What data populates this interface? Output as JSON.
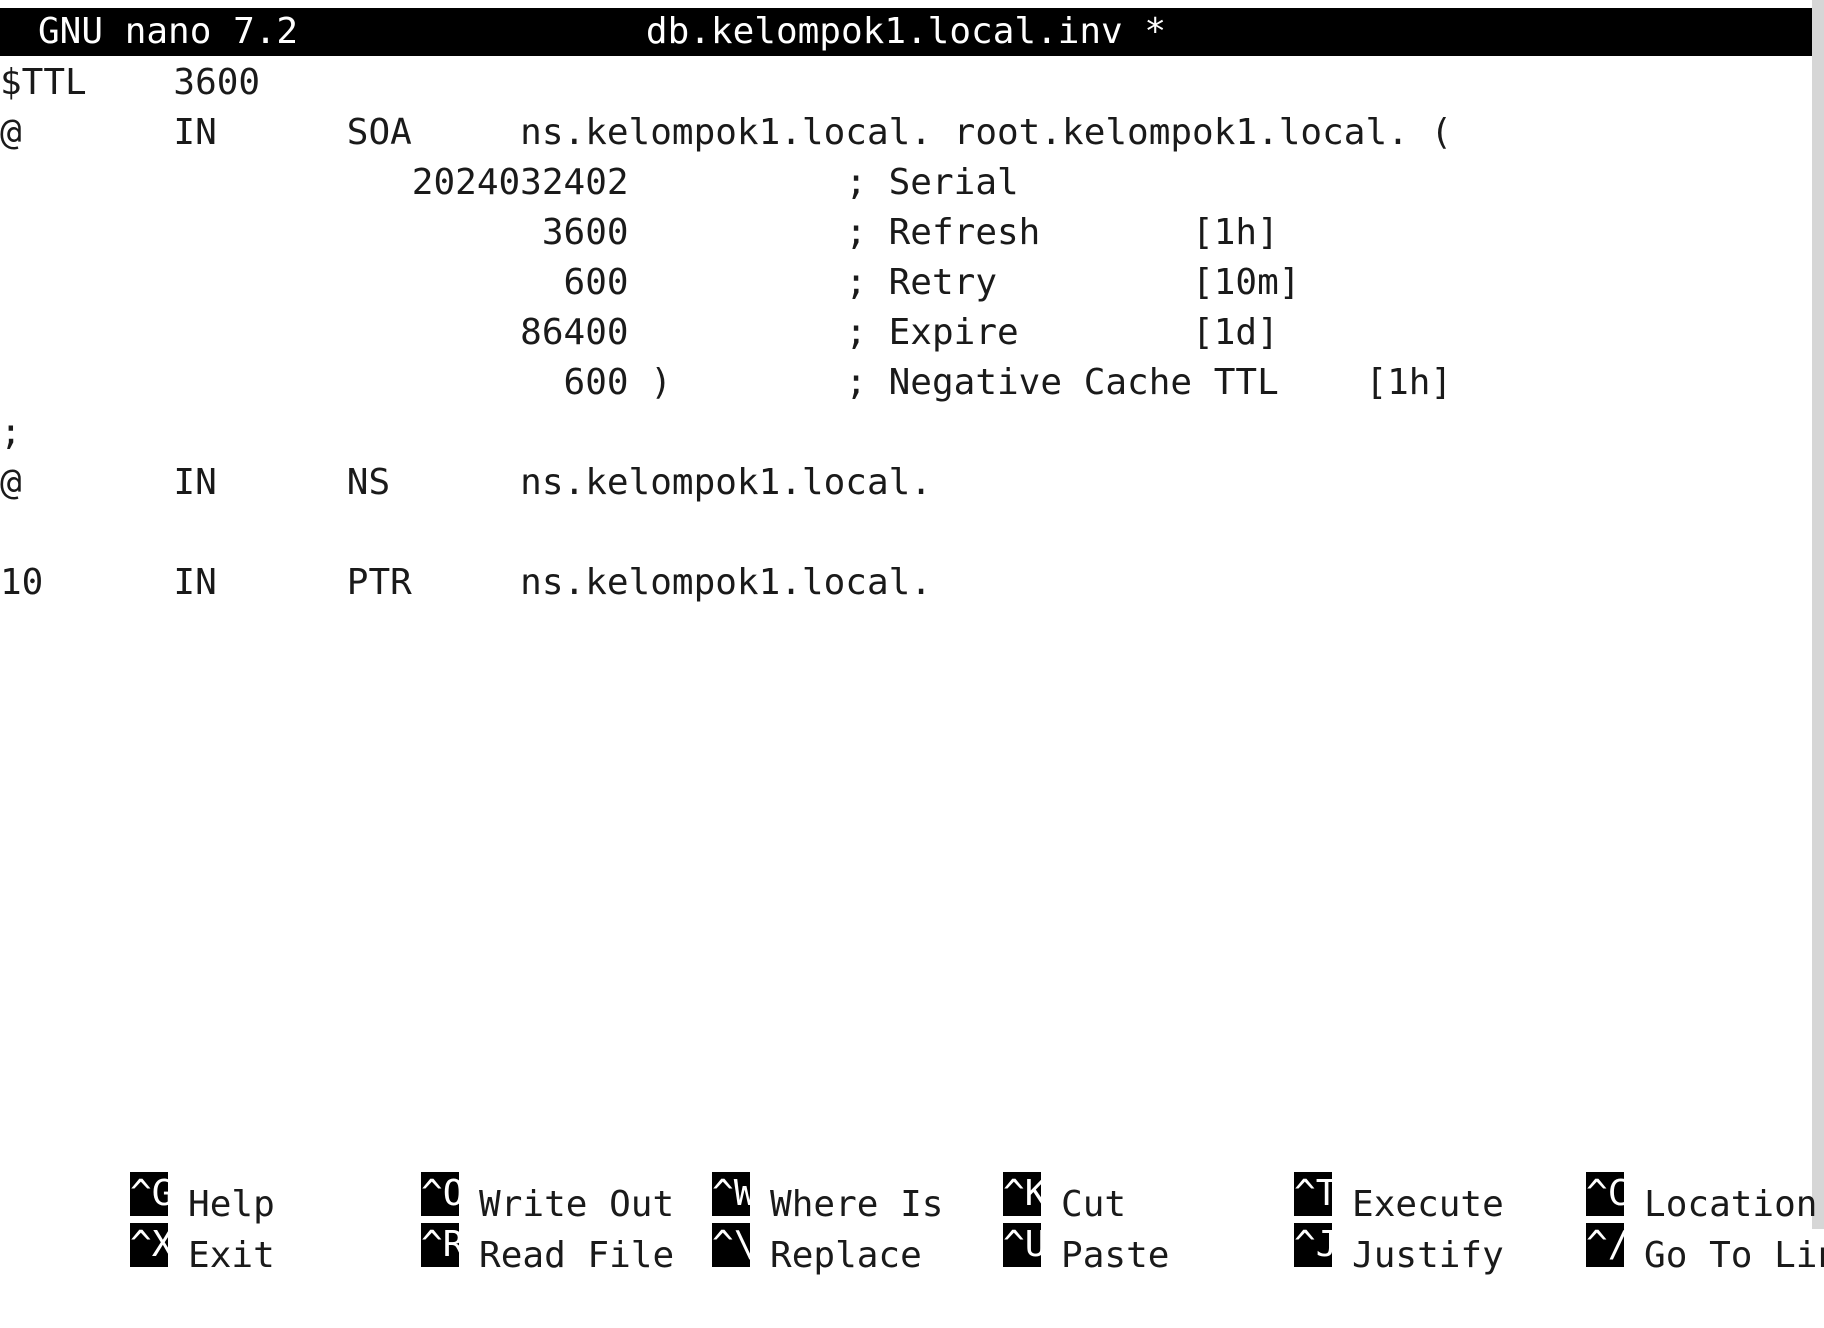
{
  "titlebar": {
    "app_version": "GNU nano 7.2",
    "filename": "db.kelompok1.local.inv *"
  },
  "editor": {
    "lines": [
      "$TTL    3600",
      "@       IN      SOA     ns.kelompok1.local. root.kelompok1.local. (",
      "                   2024032402          ; Serial",
      "                         3600          ; Refresh       [1h]",
      "                          600          ; Retry         [10m]",
      "                        86400          ; Expire        [1d]",
      "                          600 )        ; Negative Cache TTL    [1h]",
      ";",
      "@       IN      NS      ns.kelompok1.local.",
      "",
      "10      IN      PTR     ns.kelompok1.local."
    ]
  },
  "shortcuts": {
    "row1": [
      {
        "key": "^G",
        "label": "Help"
      },
      {
        "key": "^O",
        "label": "Write Out"
      },
      {
        "key": "^W",
        "label": "Where Is"
      },
      {
        "key": "^K",
        "label": "Cut"
      },
      {
        "key": "^T",
        "label": "Execute"
      },
      {
        "key": "^C",
        "label": "Location"
      }
    ],
    "row2": [
      {
        "key": "^X",
        "label": "Exit"
      },
      {
        "key": "^R",
        "label": "Read File"
      },
      {
        "key": "^\\",
        "label": "Replace"
      },
      {
        "key": "^U",
        "label": "Paste"
      },
      {
        "key": "^J",
        "label": "Justify"
      },
      {
        "key": "^/",
        "label": "Go To Line"
      }
    ]
  },
  "colors": {
    "titlebar_bg": "#000000",
    "titlebar_fg": "#ffffff",
    "text": "#1a1a1a",
    "background": "#ffffff",
    "key_bg": "#000000",
    "key_fg": "#ffffff"
  }
}
